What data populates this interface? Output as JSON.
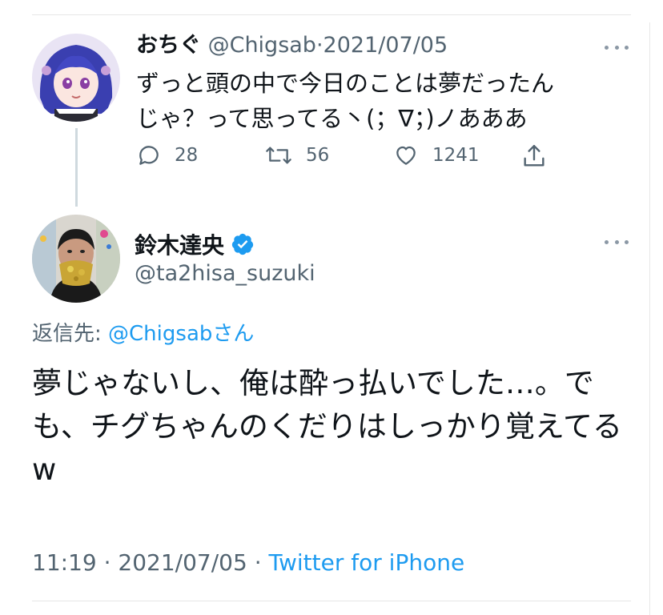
{
  "reply_tweet": {
    "display_name": "おちぐ",
    "handle": "@Chigsab",
    "separator": "·",
    "date": "2021/07/05",
    "text": "ずっと頭の中で今日のことは夢だったんじゃ？って思ってる丶(；∇；)ノあああ",
    "actions": {
      "replies": "28",
      "retweets": "56",
      "likes": "1241"
    }
  },
  "main_tweet": {
    "display_name": "鈴木達央",
    "handle": "@ta2hisa_suzuki",
    "verified": true,
    "reply_to_label": "返信先:",
    "reply_to_handle": "@Chigsabさん",
    "text": "夢じゃないし、俺は酔っ払いでした…。でも、チグちゃんのくだりはしっかり覚えてるw",
    "time": "11:19",
    "separator": "·",
    "date": "2021/07/05",
    "source": "Twitter for iPhone"
  },
  "icons": {
    "more": "more-horizontal-icon",
    "reply": "reply-bubble-icon",
    "retweet": "retweet-icon",
    "like": "heart-icon",
    "share": "share-icon",
    "verified": "verified-badge-icon"
  },
  "colors": {
    "accent": "#1d9bf0",
    "secondary_text": "#536471",
    "primary_text": "#0f1419"
  }
}
